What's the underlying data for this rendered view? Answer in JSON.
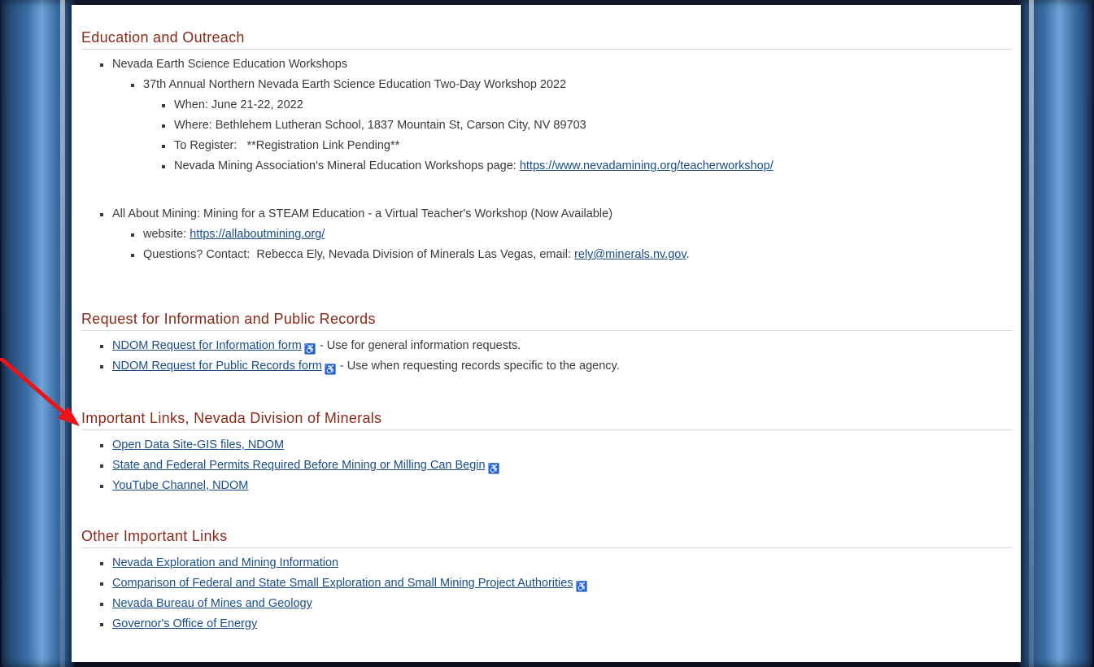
{
  "sections": {
    "education": {
      "title": "Education and Outreach",
      "workshops_label": "Nevada Earth Science Education Workshops",
      "annual_label": "37th Annual Northern Nevada Earth Science Education Two-Day Workshop 2022",
      "when": "When: June 21-22, 2022",
      "where": "Where: Bethlehem Lutheran School, 1837 Mountain St, Carson City, NV 89703",
      "register": "To Register:   **Registration Link Pending**",
      "nma_prefix": "Nevada Mining Association's Mineral Education Workshops page: ",
      "nma_link": "https://www.nevadamining.org/teacherworkshop/",
      "aam_label": "All About Mining: Mining for a STEAM Education - a Virtual Teacher's Workshop (Now Available)",
      "website_prefix": "website: ",
      "website_link": "https://allaboutmining.org/",
      "questions_prefix": "Questions? Contact:  Rebecca Ely, Nevada Division of Minerals Las Vegas, email: ",
      "questions_email": "rely@minerals.nv.gov",
      "questions_suffix": "."
    },
    "records": {
      "title": "Request for Information and Public Records",
      "info_link": "NDOM Request for Information form",
      "info_desc": " - Use for general information requests.",
      "public_link": "NDOM Request for Public Records form",
      "public_desc": " - Use when requesting records specific to the agency."
    },
    "ndom_links": {
      "title": "Important Links, Nevada Division of Minerals",
      "items": [
        "Open Data Site-GIS files, NDOM",
        "State and Federal Permits Required Before Mining or Milling Can Begin",
        "YouTube Channel, NDOM"
      ]
    },
    "other_links": {
      "title": "Other Important Links",
      "items": [
        "Nevada Exploration and Mining Information",
        "Comparison of Federal and State Small Exploration and Small Mining Project Authorities",
        "Nevada Bureau of Mines and Geology",
        "Governor's Office of Energy"
      ]
    }
  },
  "icons": {
    "pdf": "accessibility-pdf-icon",
    "pointer": "red-arrow-icon"
  },
  "colors": {
    "heading": "#8b2a1a",
    "link": "#1a4e8a",
    "arrow": "#e8141b",
    "pillar": "#3b6ea5"
  }
}
